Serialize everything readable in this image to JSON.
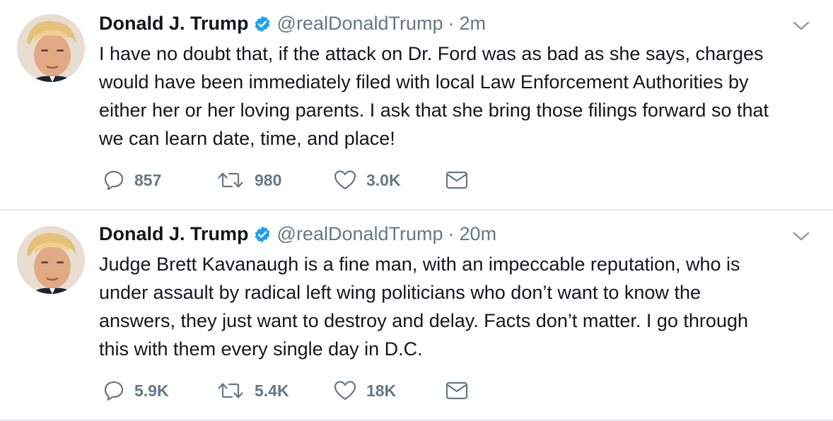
{
  "tweets": [
    {
      "name": "Donald J. Trump",
      "handle": "@realDonaldTrump",
      "separator": "·",
      "time": "2m",
      "text": "I have no doubt that, if the attack on Dr. Ford was as bad as she says, charges\nwould have been immediately filed with local Law Enforcement Authorities by\neither her or her loving parents. I ask that she bring those filings forward so that\nwe can learn  date, time, and place!",
      "replies": "857",
      "retweets": "980",
      "likes": "3.0K"
    },
    {
      "name": "Donald J. Trump",
      "handle": "@realDonaldTrump",
      "separator": "·",
      "time": "20m",
      "text": "Judge Brett Kavanaugh is a fine man, with an impeccable reputation, who is\nunder assault by radical left wing politicians who don’t want to know the\nanswers, they just want to destroy and delay. Facts don’t matter. I go through\nthis with them every single day in D.C.",
      "replies": "5.9K",
      "retweets": "5.4K",
      "likes": "18K"
    }
  ],
  "colors": {
    "verified": "#1da1f2",
    "secondary_text": "#657786",
    "divider": "#e6ecf0"
  },
  "icons": [
    "verified-badge-icon",
    "chevron-down-icon",
    "reply-icon",
    "retweet-icon",
    "like-icon",
    "direct-message-icon"
  ]
}
